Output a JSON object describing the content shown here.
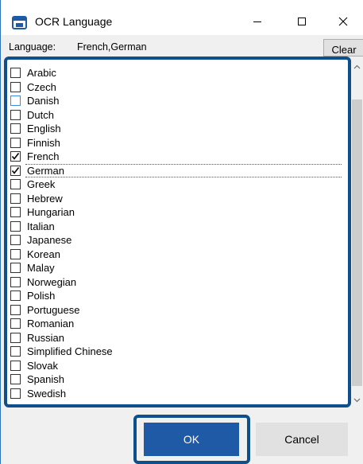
{
  "window": {
    "title": "OCR Language",
    "minimize_icon": "minimize-icon",
    "maximize_icon": "maximize-icon",
    "close_icon": "close-icon"
  },
  "language_row": {
    "label": "Language:",
    "value": "French,German",
    "clear_label": "Clear"
  },
  "languages": [
    {
      "label": "Arabic",
      "checked": false
    },
    {
      "label": "Czech",
      "checked": false
    },
    {
      "label": "Danish",
      "checked": false
    },
    {
      "label": "Dutch",
      "checked": false
    },
    {
      "label": "English",
      "checked": false
    },
    {
      "label": "Finnish",
      "checked": false
    },
    {
      "label": "French",
      "checked": true
    },
    {
      "label": "German",
      "checked": true
    },
    {
      "label": "Greek",
      "checked": false
    },
    {
      "label": "Hebrew",
      "checked": false
    },
    {
      "label": "Hungarian",
      "checked": false
    },
    {
      "label": "Italian",
      "checked": false
    },
    {
      "label": "Japanese",
      "checked": false
    },
    {
      "label": "Korean",
      "checked": false
    },
    {
      "label": "Malay",
      "checked": false
    },
    {
      "label": "Norwegian",
      "checked": false
    },
    {
      "label": "Polish",
      "checked": false
    },
    {
      "label": "Portuguese",
      "checked": false
    },
    {
      "label": "Romanian",
      "checked": false
    },
    {
      "label": "Russian",
      "checked": false
    },
    {
      "label": "Simplified Chinese",
      "checked": false
    },
    {
      "label": "Slovak",
      "checked": false
    },
    {
      "label": "Spanish",
      "checked": false
    },
    {
      "label": "Swedish",
      "checked": false
    }
  ],
  "buttons": {
    "ok_label": "OK",
    "cancel_label": "Cancel"
  },
  "colors": {
    "accent": "#1f5aa6",
    "highlight_frame": "#0f4f8c"
  }
}
